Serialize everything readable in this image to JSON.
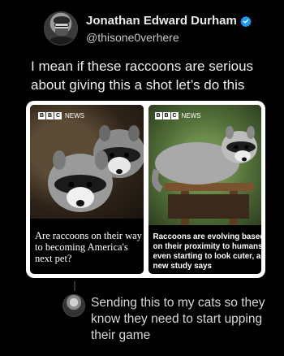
{
  "tweet": {
    "author_name": "Jonathan Edward Durham",
    "handle": "@thisone0verhere",
    "verified": true,
    "text": "I mean if these raccoons are serious about giving this a shot let’s do this"
  },
  "media": {
    "left": {
      "source_logo": "BBC",
      "source_label": "NEWS",
      "caption": "Are raccoons on their way to becoming America's next pet?"
    },
    "right": {
      "source_logo": "BBC",
      "source_label": "NEWS",
      "caption": "Raccoons are evolving based on their proximity to humans, even starting to look cuter, a new study says"
    }
  },
  "reply": {
    "text": "Sending this to my cats so they know they need to start upping their game"
  },
  "colors": {
    "background": "#000000",
    "verified_badge": "#1d9bf0",
    "text": "#e7e9ea"
  }
}
